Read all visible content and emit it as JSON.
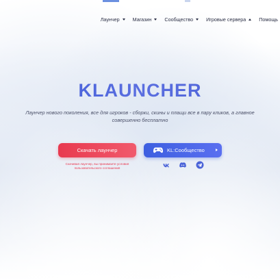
{
  "nav": {
    "items": [
      {
        "label": "Лаунчер",
        "caret": "down"
      },
      {
        "label": "Магазин",
        "caret": "down"
      },
      {
        "label": "Сообщество",
        "caret": "down"
      },
      {
        "label": "Игровые сервера",
        "caret": "up"
      },
      {
        "label": "Помощь",
        "caret": ""
      }
    ]
  },
  "hero": {
    "title": "KLAUNCHER",
    "subtitle": "Лаунчер нового поколения, все для игроков - сборки, скины и плащи все в пару кликов, а главное совершенно бесплатно"
  },
  "actions": {
    "download_label": "Скачать лаунчер",
    "community_label": "KL:Сообщество",
    "terms_text": "Скачивая лаунчер, вы принимаете условия пользовательского соглашения"
  },
  "socials": [
    "vk-icon",
    "discord-icon",
    "telegram-icon"
  ],
  "colors": {
    "accent_blue": "#4a63d8",
    "accent_red": "#e8394f",
    "text_dark": "#2b2f45"
  }
}
